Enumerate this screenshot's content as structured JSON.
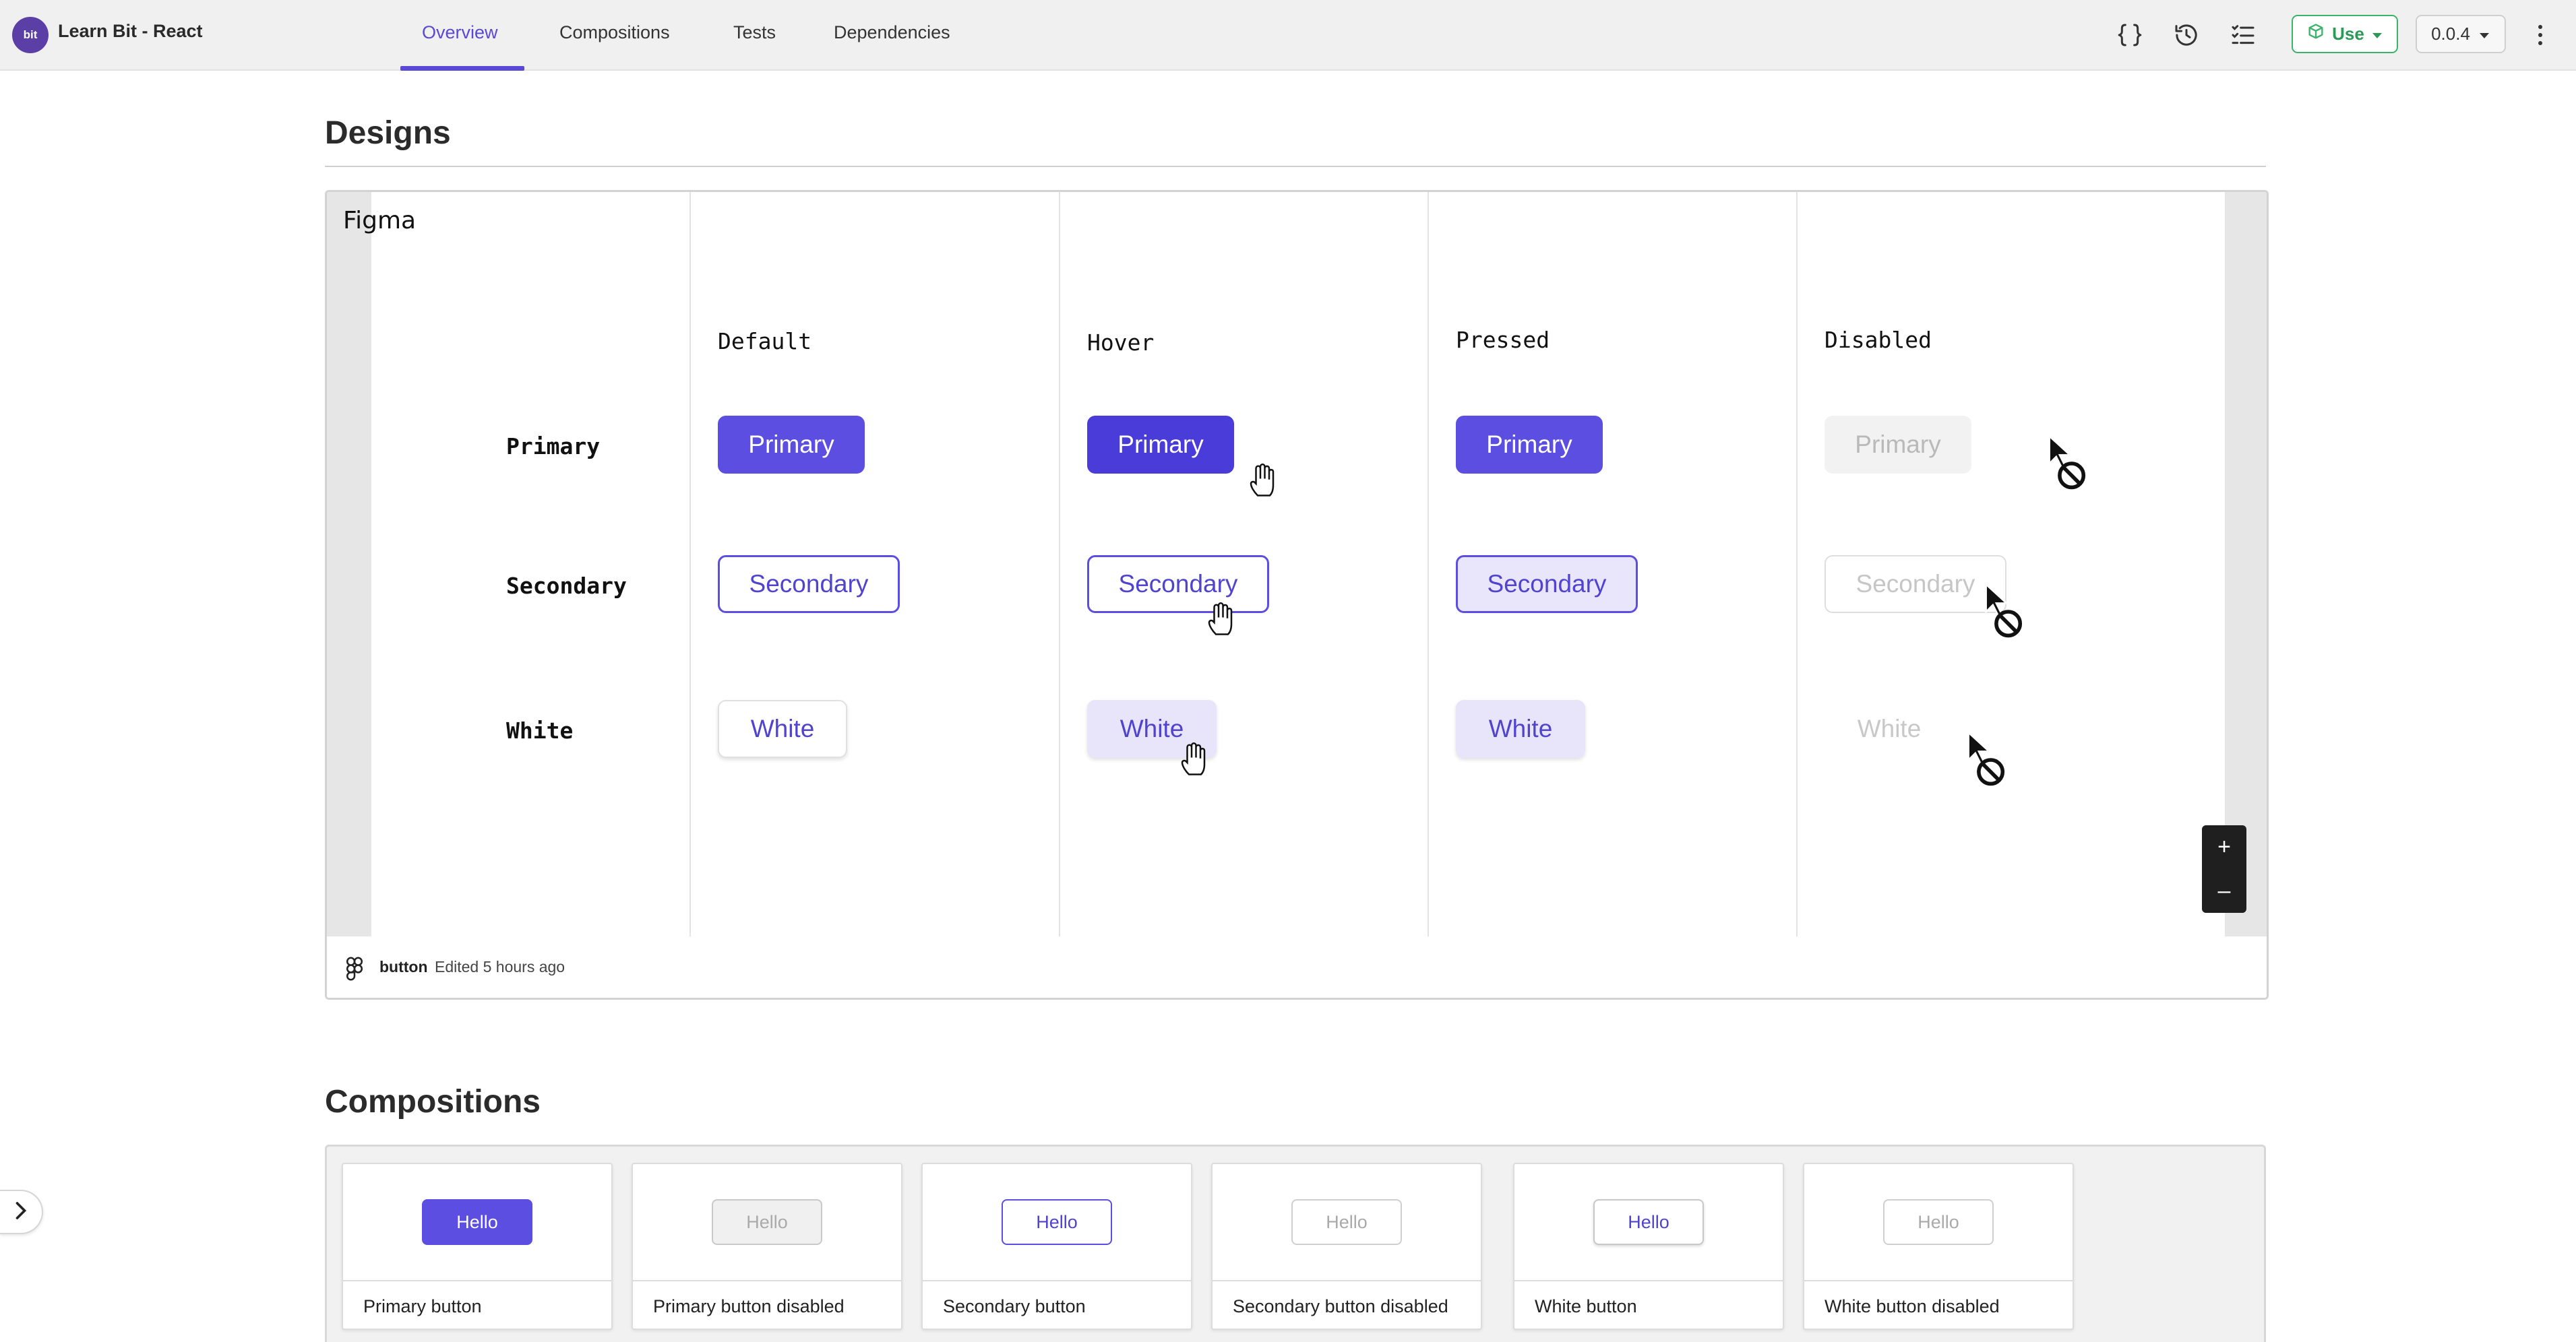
{
  "app": {
    "logo_text": "bit",
    "title": "Learn Bit - React"
  },
  "tabs": [
    {
      "label": "Overview",
      "active": true
    },
    {
      "label": "Compositions",
      "active": false
    },
    {
      "label": "Tests",
      "active": false
    },
    {
      "label": "Dependencies",
      "active": false
    }
  ],
  "toolbar": {
    "icons": [
      "code-braces-icon",
      "history-icon",
      "checklist-icon"
    ],
    "use_label": "Use",
    "version": "0.0.4"
  },
  "designs": {
    "title": "Designs",
    "embed_label": "Figma",
    "columns": [
      "Default",
      "Hover",
      "Pressed",
      "Disabled"
    ],
    "rows": [
      "Primary",
      "Secondary",
      "White"
    ],
    "buttons": {
      "primary": "Primary",
      "secondary": "Secondary",
      "white": "White"
    },
    "zoom_in": "+",
    "zoom_out": "–",
    "footer_file": "button",
    "footer_edited": "Edited 5 hours ago"
  },
  "compositions": {
    "title": "Compositions",
    "items": [
      {
        "button_text": "Hello",
        "label": "Primary button"
      },
      {
        "button_text": "Hello",
        "label": "Primary button disabled"
      },
      {
        "button_text": "Hello",
        "label": "Secondary button"
      },
      {
        "button_text": "Hello",
        "label": "Secondary button disabled"
      },
      {
        "button_text": "Hello",
        "label": "White button"
      },
      {
        "button_text": "Hello",
        "label": "White button disabled"
      }
    ]
  },
  "colors": {
    "accent": "#5a48d6",
    "button_primary": "#5b4ee0",
    "use_green": "#2b9a58"
  }
}
